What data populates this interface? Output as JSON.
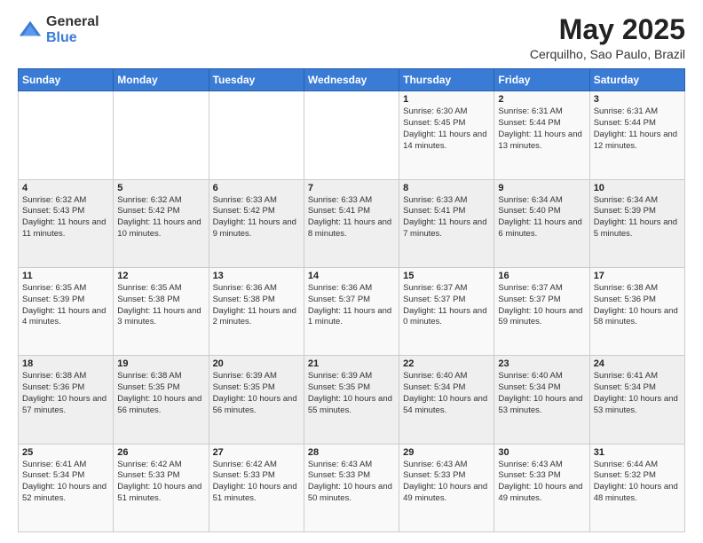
{
  "logo": {
    "general": "General",
    "blue": "Blue"
  },
  "title": "May 2025",
  "location": "Cerquilho, Sao Paulo, Brazil",
  "days_of_week": [
    "Sunday",
    "Monday",
    "Tuesday",
    "Wednesday",
    "Thursday",
    "Friday",
    "Saturday"
  ],
  "weeks": [
    [
      {
        "day": "",
        "info": ""
      },
      {
        "day": "",
        "info": ""
      },
      {
        "day": "",
        "info": ""
      },
      {
        "day": "",
        "info": ""
      },
      {
        "day": "1",
        "info": "Sunrise: 6:30 AM\nSunset: 5:45 PM\nDaylight: 11 hours and 14 minutes."
      },
      {
        "day": "2",
        "info": "Sunrise: 6:31 AM\nSunset: 5:44 PM\nDaylight: 11 hours and 13 minutes."
      },
      {
        "day": "3",
        "info": "Sunrise: 6:31 AM\nSunset: 5:44 PM\nDaylight: 11 hours and 12 minutes."
      }
    ],
    [
      {
        "day": "4",
        "info": "Sunrise: 6:32 AM\nSunset: 5:43 PM\nDaylight: 11 hours and 11 minutes."
      },
      {
        "day": "5",
        "info": "Sunrise: 6:32 AM\nSunset: 5:42 PM\nDaylight: 11 hours and 10 minutes."
      },
      {
        "day": "6",
        "info": "Sunrise: 6:33 AM\nSunset: 5:42 PM\nDaylight: 11 hours and 9 minutes."
      },
      {
        "day": "7",
        "info": "Sunrise: 6:33 AM\nSunset: 5:41 PM\nDaylight: 11 hours and 8 minutes."
      },
      {
        "day": "8",
        "info": "Sunrise: 6:33 AM\nSunset: 5:41 PM\nDaylight: 11 hours and 7 minutes."
      },
      {
        "day": "9",
        "info": "Sunrise: 6:34 AM\nSunset: 5:40 PM\nDaylight: 11 hours and 6 minutes."
      },
      {
        "day": "10",
        "info": "Sunrise: 6:34 AM\nSunset: 5:39 PM\nDaylight: 11 hours and 5 minutes."
      }
    ],
    [
      {
        "day": "11",
        "info": "Sunrise: 6:35 AM\nSunset: 5:39 PM\nDaylight: 11 hours and 4 minutes."
      },
      {
        "day": "12",
        "info": "Sunrise: 6:35 AM\nSunset: 5:38 PM\nDaylight: 11 hours and 3 minutes."
      },
      {
        "day": "13",
        "info": "Sunrise: 6:36 AM\nSunset: 5:38 PM\nDaylight: 11 hours and 2 minutes."
      },
      {
        "day": "14",
        "info": "Sunrise: 6:36 AM\nSunset: 5:37 PM\nDaylight: 11 hours and 1 minute."
      },
      {
        "day": "15",
        "info": "Sunrise: 6:37 AM\nSunset: 5:37 PM\nDaylight: 11 hours and 0 minutes."
      },
      {
        "day": "16",
        "info": "Sunrise: 6:37 AM\nSunset: 5:37 PM\nDaylight: 10 hours and 59 minutes."
      },
      {
        "day": "17",
        "info": "Sunrise: 6:38 AM\nSunset: 5:36 PM\nDaylight: 10 hours and 58 minutes."
      }
    ],
    [
      {
        "day": "18",
        "info": "Sunrise: 6:38 AM\nSunset: 5:36 PM\nDaylight: 10 hours and 57 minutes."
      },
      {
        "day": "19",
        "info": "Sunrise: 6:38 AM\nSunset: 5:35 PM\nDaylight: 10 hours and 56 minutes."
      },
      {
        "day": "20",
        "info": "Sunrise: 6:39 AM\nSunset: 5:35 PM\nDaylight: 10 hours and 56 minutes."
      },
      {
        "day": "21",
        "info": "Sunrise: 6:39 AM\nSunset: 5:35 PM\nDaylight: 10 hours and 55 minutes."
      },
      {
        "day": "22",
        "info": "Sunrise: 6:40 AM\nSunset: 5:34 PM\nDaylight: 10 hours and 54 minutes."
      },
      {
        "day": "23",
        "info": "Sunrise: 6:40 AM\nSunset: 5:34 PM\nDaylight: 10 hours and 53 minutes."
      },
      {
        "day": "24",
        "info": "Sunrise: 6:41 AM\nSunset: 5:34 PM\nDaylight: 10 hours and 53 minutes."
      }
    ],
    [
      {
        "day": "25",
        "info": "Sunrise: 6:41 AM\nSunset: 5:34 PM\nDaylight: 10 hours and 52 minutes."
      },
      {
        "day": "26",
        "info": "Sunrise: 6:42 AM\nSunset: 5:33 PM\nDaylight: 10 hours and 51 minutes."
      },
      {
        "day": "27",
        "info": "Sunrise: 6:42 AM\nSunset: 5:33 PM\nDaylight: 10 hours and 51 minutes."
      },
      {
        "day": "28",
        "info": "Sunrise: 6:43 AM\nSunset: 5:33 PM\nDaylight: 10 hours and 50 minutes."
      },
      {
        "day": "29",
        "info": "Sunrise: 6:43 AM\nSunset: 5:33 PM\nDaylight: 10 hours and 49 minutes."
      },
      {
        "day": "30",
        "info": "Sunrise: 6:43 AM\nSunset: 5:33 PM\nDaylight: 10 hours and 49 minutes."
      },
      {
        "day": "31",
        "info": "Sunrise: 6:44 AM\nSunset: 5:32 PM\nDaylight: 10 hours and 48 minutes."
      }
    ]
  ]
}
